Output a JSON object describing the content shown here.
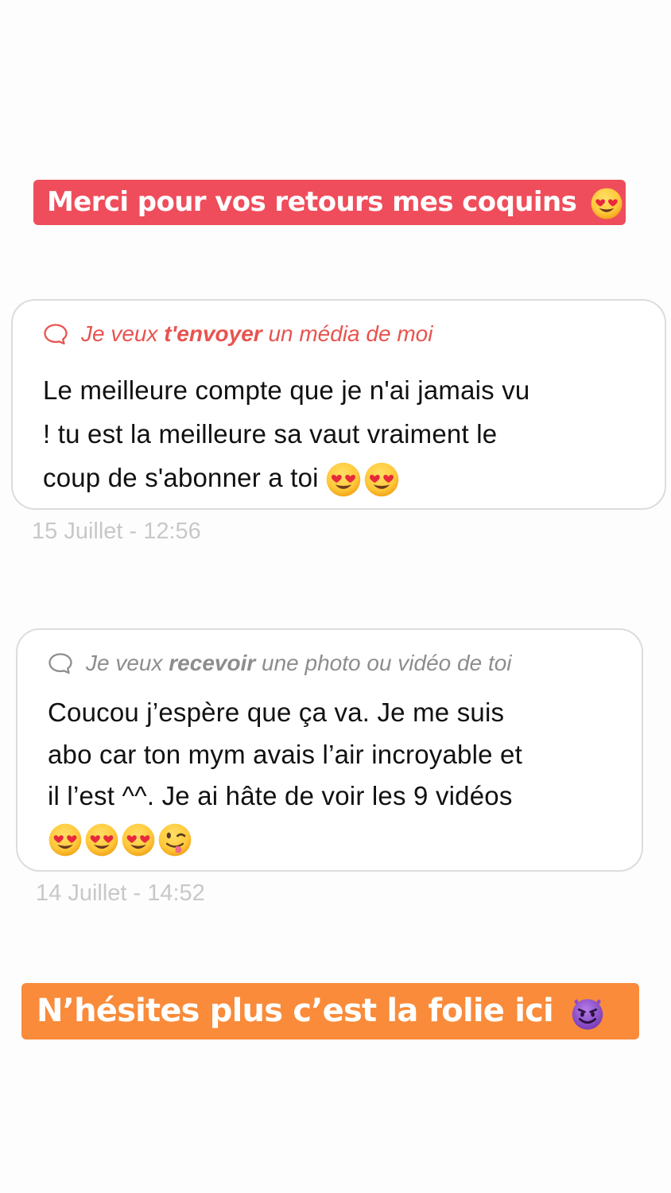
{
  "banners": {
    "top": {
      "text": "Merci pour vos retours mes coquins",
      "emoji_icon": "heart-eyes-emoji",
      "background": "#ef4d5b"
    },
    "bottom": {
      "text": "N’hésites plus c’est la folie ici",
      "emoji_icon": "smiling-devil-emoji",
      "background": "#f98b3a"
    }
  },
  "messages": [
    {
      "question_icon": "speech-bubble-icon",
      "question_prefix": "Je veux",
      "question_emphasis": "t'envoyer",
      "question_suffix": "un média de moi",
      "question_color": "#e8534f",
      "lines": [
        "Le meilleure compte que je n'ai jamais vu",
        "! tu est la meilleure sa vaut vraiment le",
        "coup de s'abonner a toi"
      ],
      "emojis": [
        "heart-eyes-emoji",
        "heart-eyes-emoji"
      ],
      "timestamp": "15 Juillet - 12:56"
    },
    {
      "question_icon": "speech-bubble-icon",
      "question_prefix": "Je veux",
      "question_emphasis": "recevoir",
      "question_suffix": "une photo ou vidéo de toi",
      "question_color": "#8d8d8d",
      "lines": [
        "Coucou j’espère que ça va. Je me suis",
        "abo car ton mym avais l’air incroyable et",
        "il l’est ^^. Je ai hâte de voir les 9 vidéos"
      ],
      "emojis": [
        "heart-eyes-emoji",
        "heart-eyes-emoji",
        "heart-eyes-emoji",
        "winking-tongue-emoji"
      ],
      "timestamp": "14 Juillet - 14:52"
    }
  ]
}
